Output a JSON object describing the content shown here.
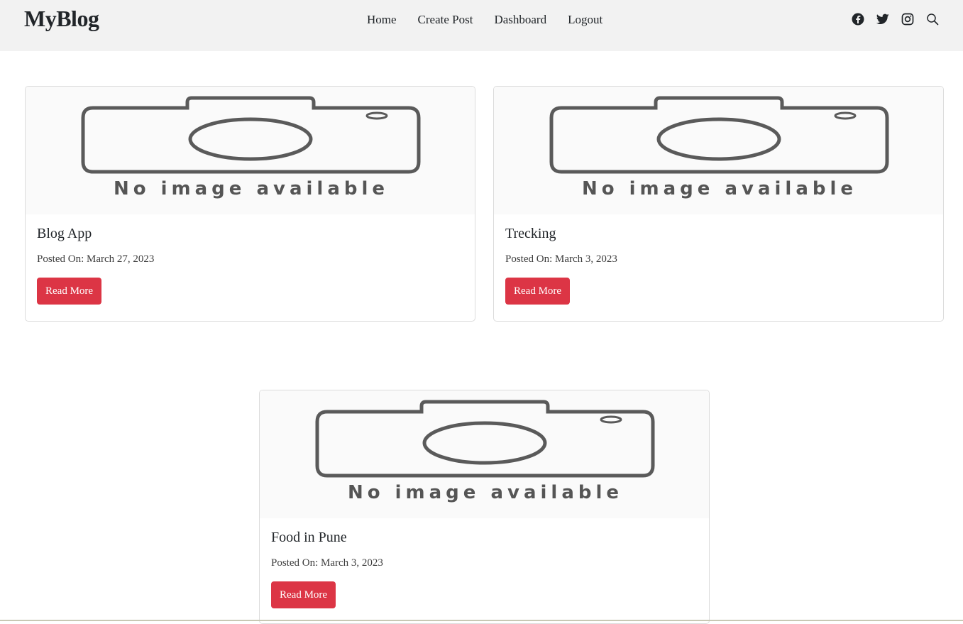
{
  "brand": "MyBlog",
  "nav": {
    "links": [
      "Home",
      "Create Post",
      "Dashboard",
      "Logout"
    ],
    "icons": [
      "facebook-icon",
      "twitter-icon",
      "instagram-icon",
      "search-icon"
    ]
  },
  "placeholder_image_text": "No image available",
  "posts": [
    {
      "title": "Blog App",
      "date": "Posted On: March 27, 2023",
      "button": "Read More"
    },
    {
      "title": "Trecking",
      "date": "Posted On: March 3, 2023",
      "button": "Read More"
    },
    {
      "title": "Food in Pune",
      "date": "Posted On: March 3, 2023",
      "button": "Read More"
    }
  ],
  "colors": {
    "navbar_bg": "#f2f2f2",
    "button_bg": "#dc3545",
    "button_text": "#ffffff"
  }
}
